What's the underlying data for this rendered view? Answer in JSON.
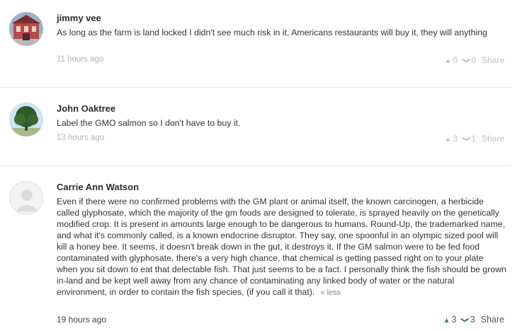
{
  "comments": [
    {
      "author": "jimmy vee",
      "text": "As long as the farm is land locked I didn't see much risk in it, Americans restaurants will buy it, they will anything",
      "time": "11 hours ago",
      "upvotes": "0",
      "downvotes": "0",
      "share_label": "Share"
    },
    {
      "author": "John Oaktree",
      "text": "Label the GMO salmon so I don't have to buy it.",
      "time": "13 hours ago",
      "upvotes": "3",
      "downvotes": "1",
      "share_label": "Share"
    },
    {
      "author": "Carrie Ann Watson",
      "text": "Even if there were no confirmed problems with the GM plant or animal itself, the known carcinogen, a herbicide called glyphosate, which the majority of the gm foods are designed to tolerate, is sprayed heavily on the genetically modified crop. It is present in amounts large enough to be dangerous to humans. Round-Up, the trademarked name, and what it's commonly called, is a known endocrine disruptor. They say, one spoonful in an olympic sized pool will kill a honey bee. It seems, it doesn't break down in the gut, it destroys it. If the GM salmon were to be fed food contaminated with glyphosate, there's a very high chance, that chemical is getting passed right on to your plate when you sit down to eat that delectable fish. That just seems to be a fact. I personally think the fish should be grown in-land and be kept well away from any chance of contaminating any linked body of water or the natural environment, in order to contain the fish species, (if you call it that).",
      "less_label": "« less",
      "time": "19 hours ago",
      "upvotes": "3",
      "downvotes": "3",
      "share_label": "Share"
    }
  ],
  "icons": {
    "upvote": "triangle-up",
    "downvote": "chevron-down"
  }
}
